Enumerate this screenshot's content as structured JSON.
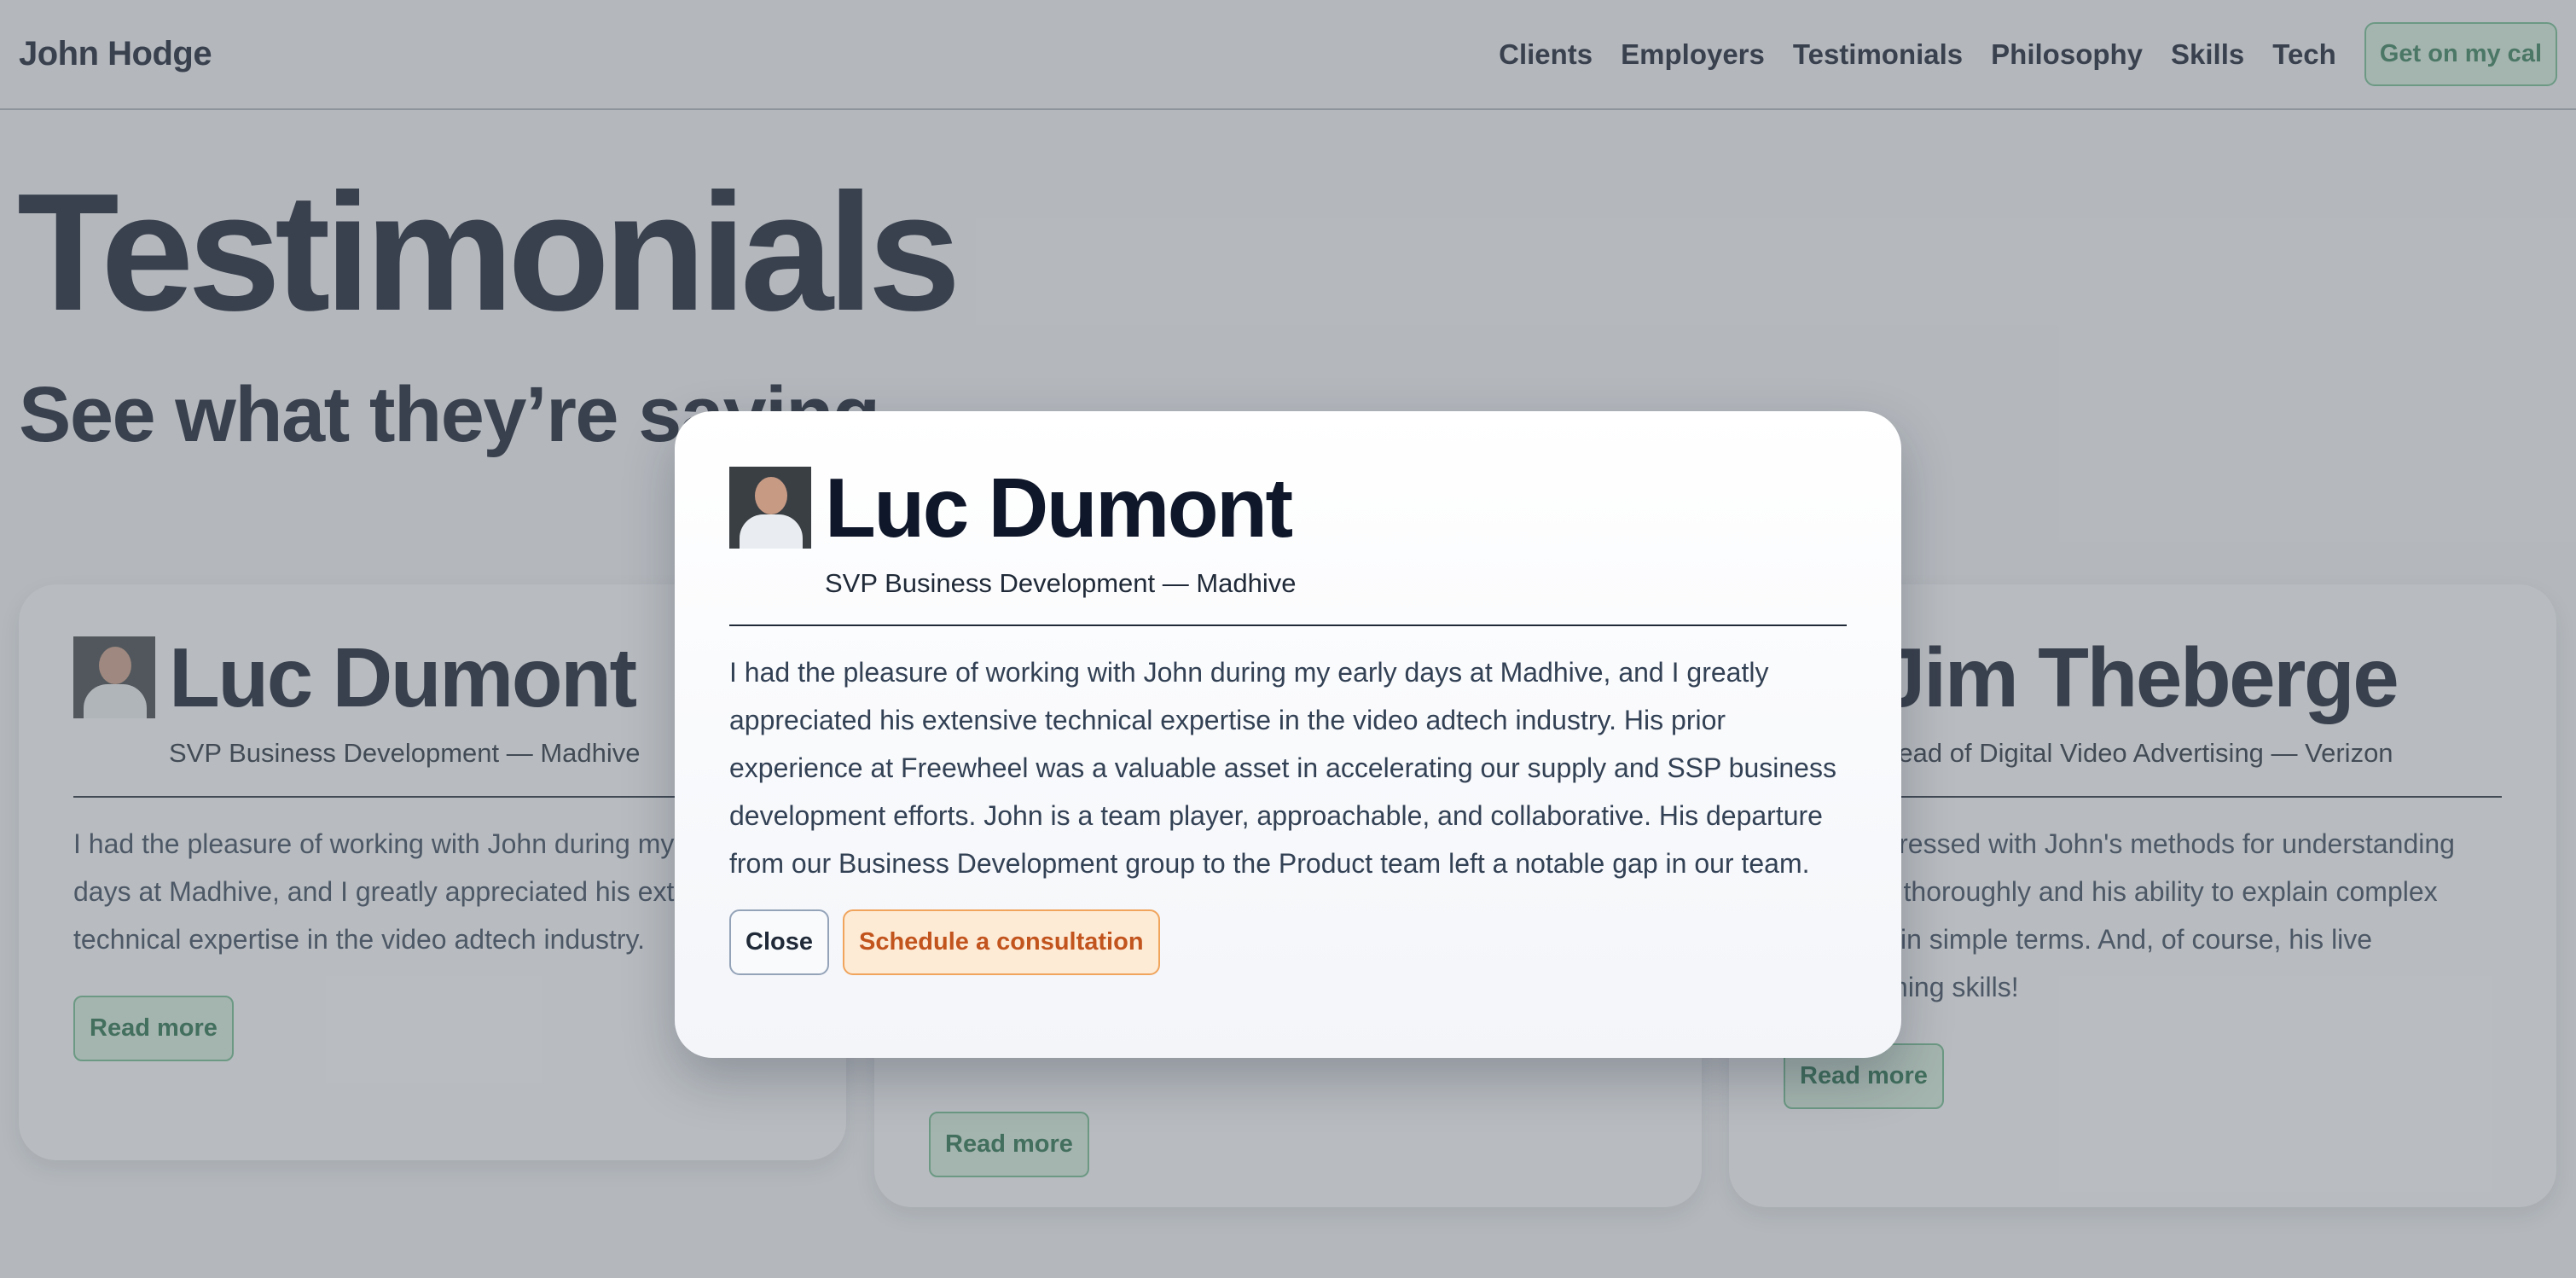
{
  "nav": {
    "brand": "John Hodge",
    "links": [
      "Clients",
      "Employers",
      "Testimonials",
      "Philosophy",
      "Skills",
      "Tech"
    ],
    "cta_label": "Get on my cal"
  },
  "hero": {
    "title": "Testimonials",
    "subtitle": "See what they’re saying"
  },
  "cards": [
    {
      "name": "Luc Dumont",
      "role": "SVP Business Development — Madhive",
      "quote": "I had the pleasure of working with John during my early days at Madhive, and I greatly appreciated his extensive technical expertise in the video adtech industry.",
      "read_more": "Read more"
    },
    {
      "name": "",
      "role": "",
      "quote": "",
      "read_more": "Read more"
    },
    {
      "name": "Jim Theberge",
      "role": "Head of Digital Video Advertising — Verizon",
      "quote": "I was impressed with John's methods for understanding problems thoroughly and his ability to explain complex concepts in simple terms. And, of course, his live programming skills!",
      "read_more": "Read more"
    }
  ],
  "modal": {
    "name": "Luc Dumont",
    "role": "SVP Business Development — Madhive",
    "quote": "I had the pleasure of working with John during my early days at Madhive, and I greatly appreciated his extensive technical expertise in the video adtech industry. His prior experience at Freewheel was a valuable asset in accelerating our supply and SSP business development efforts. John is a team player, approachable, and collaborative. His departure from our Business Development group to the Product team left a notable gap in our team.",
    "close_label": "Close",
    "schedule_label": "Schedule a consultation"
  },
  "colors": {
    "accent_green": "#2f7a55",
    "accent_orange": "#c2541e",
    "text_dark": "#0f172a"
  }
}
